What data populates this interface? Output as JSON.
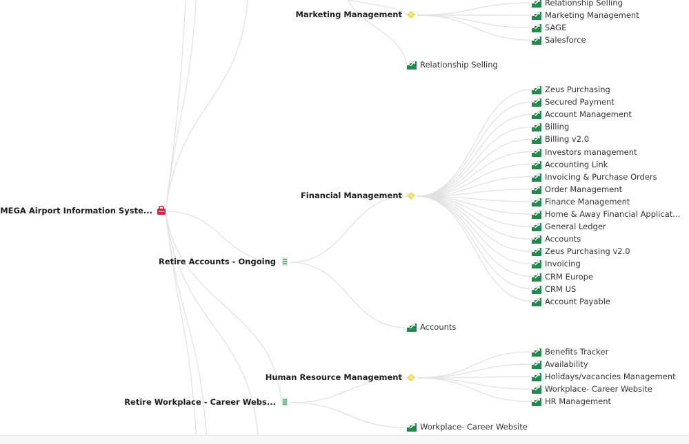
{
  "diagram": {
    "type": "tree",
    "root": {
      "label": "MEGA Airport Information Syste...",
      "icon": "system-icon"
    },
    "branches": [
      {
        "label": "Marketing Management",
        "icon": "capability-icon",
        "children": [
          "Relationship Selling",
          "Marketing Management",
          "SAGE",
          "Salesforce"
        ]
      },
      {
        "label": "Relationship Selling",
        "icon": "application-icon",
        "leaf": true
      },
      {
        "label": "Retire Accounts - Ongoing",
        "icon": "project-icon",
        "children": [
          {
            "label": "Financial Management",
            "icon": "capability-icon",
            "children": [
              "Zeus Purchasing",
              "Secured Payment",
              "Account Management",
              "Billing",
              "Billing v2.0",
              "Investors management",
              "Accounting Link",
              "Invoicing & Purchase Orders",
              "Order Management",
              "Finance Management",
              "Home & Away Financial Applicat...",
              "General Ledger",
              "Accounts",
              "Zeus Purchasing v2.0",
              "Invoicing",
              "CRM Europe",
              "CRM US",
              "Account Payable"
            ]
          },
          {
            "label": "Accounts",
            "icon": "application-icon",
            "leaf": true
          }
        ]
      },
      {
        "label": "Retire Workplace - Career Webs...",
        "icon": "project-icon",
        "children": [
          {
            "label": "Human Resource Management",
            "icon": "capability-icon",
            "children": [
              "Benefits Tracker",
              "Availability",
              "Holidays/vacancies Management",
              "Workplace- Career Website",
              "HR Management"
            ]
          },
          {
            "label": "Workplace- Career Website",
            "icon": "application-icon",
            "leaf": true
          }
        ]
      }
    ],
    "colors": {
      "link": "#e2e2e2",
      "root_icon": "#d0284a",
      "capability_icon": "#f3d548",
      "project_icon": "#8fc4a8",
      "application_icon": "#1f8a4c"
    }
  },
  "nodes": {
    "root": "MEGA Airport Information Syste...",
    "marketing": "Marketing Management",
    "rel_selling": "Relationship Selling",
    "retire_accounts": "Retire Accounts - Ongoing",
    "financial": "Financial Management",
    "accounts": "Accounts",
    "retire_workplace": "Retire Workplace - Career Webs...",
    "hr": "Human Resource Management",
    "workplace": "Workplace- Career Website",
    "mk_leaves": [
      "Relationship Selling",
      "Marketing Management",
      "SAGE",
      "Salesforce"
    ],
    "fin_leaves": [
      "Zeus Purchasing",
      "Secured Payment",
      "Account Management",
      "Billing",
      "Billing v2.0",
      "Investors management",
      "Accounting Link",
      "Invoicing & Purchase Orders",
      "Order Management",
      "Finance Management",
      "Home & Away Financial Applicat...",
      "General Ledger",
      "Accounts",
      "Zeus Purchasing v2.0",
      "Invoicing",
      "CRM Europe",
      "CRM US",
      "Account Payable"
    ],
    "hr_leaves": [
      "Benefits Tracker",
      "Availability",
      "Holidays/vacancies Management",
      "Workplace- Career Website",
      "HR Management"
    ]
  }
}
